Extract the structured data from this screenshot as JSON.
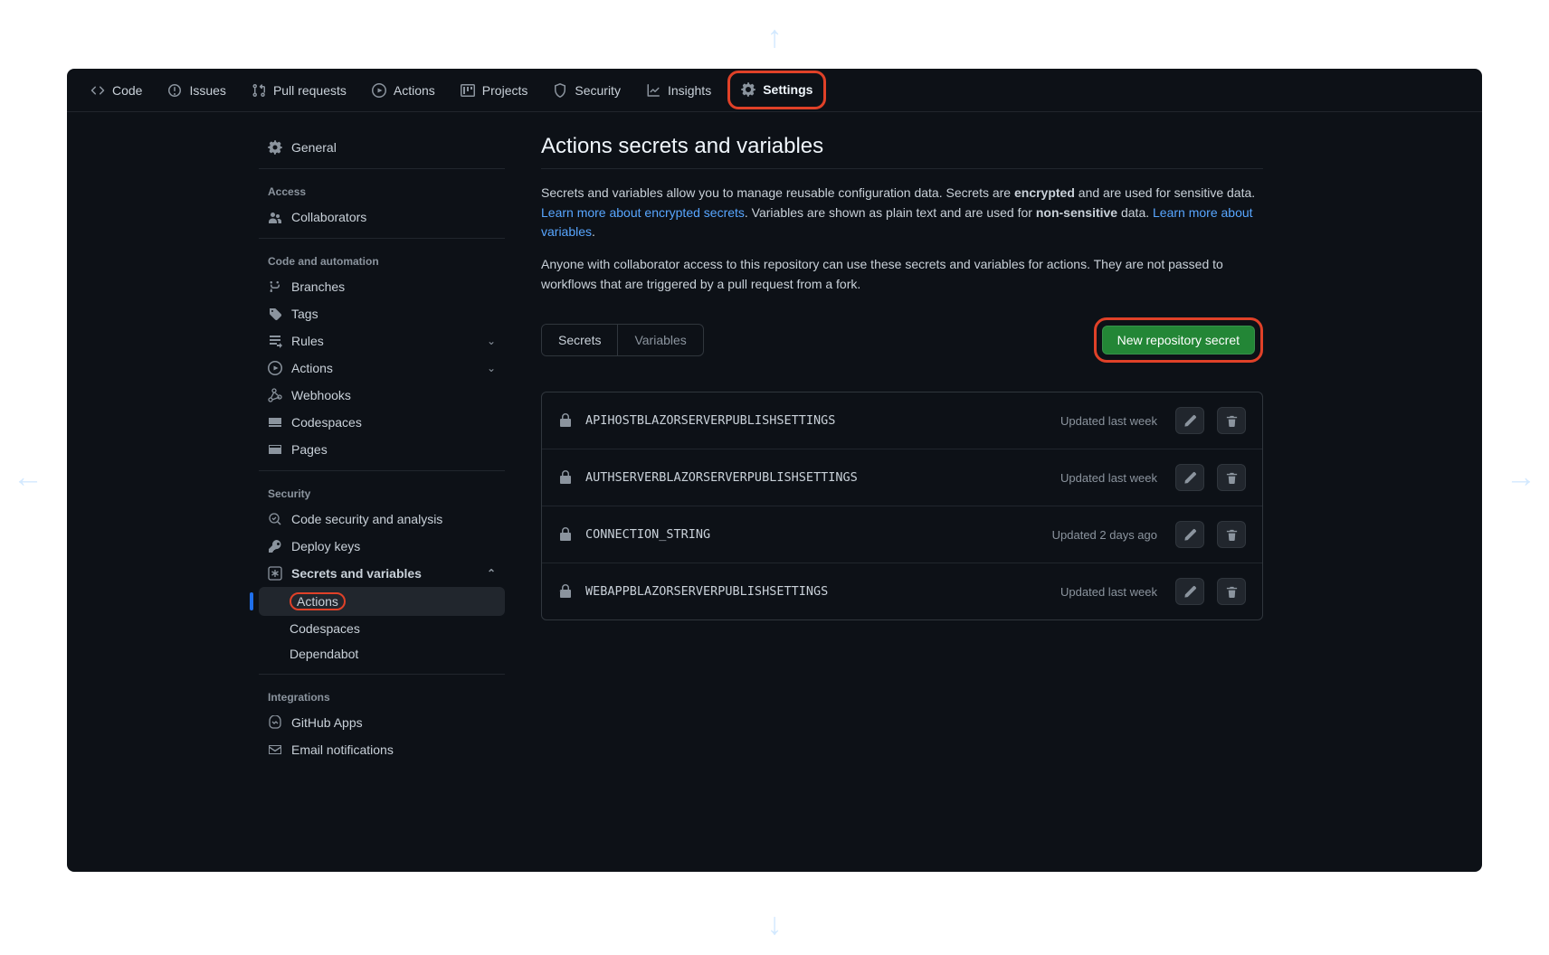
{
  "topnav": {
    "items": [
      {
        "label": "Code",
        "icon": "code"
      },
      {
        "label": "Issues",
        "icon": "issue"
      },
      {
        "label": "Pull requests",
        "icon": "pr"
      },
      {
        "label": "Actions",
        "icon": "play"
      },
      {
        "label": "Projects",
        "icon": "project"
      },
      {
        "label": "Security",
        "icon": "shield"
      },
      {
        "label": "Insights",
        "icon": "graph"
      },
      {
        "label": "Settings",
        "icon": "gear"
      }
    ]
  },
  "sidebar": {
    "general": "General",
    "section_access": "Access",
    "collaborators": "Collaborators",
    "section_code": "Code and automation",
    "branches": "Branches",
    "tags": "Tags",
    "rules": "Rules",
    "actions": "Actions",
    "webhooks": "Webhooks",
    "codespaces": "Codespaces",
    "pages": "Pages",
    "section_security": "Security",
    "code_security": "Code security and analysis",
    "deploy_keys": "Deploy keys",
    "secrets_vars": "Secrets and variables",
    "sv_actions": "Actions",
    "sv_codespaces": "Codespaces",
    "sv_dependabot": "Dependabot",
    "section_integrations": "Integrations",
    "github_apps": "GitHub Apps",
    "email_notifications": "Email notifications"
  },
  "main": {
    "title": "Actions secrets and variables",
    "desc1_a": "Secrets and variables allow you to manage reusable configuration data. Secrets are ",
    "desc1_b_bold": "encrypted",
    "desc1_c": " and are used for sensitive data. ",
    "link1": "Learn more about encrypted secrets",
    "desc1_d": ". Variables are shown as plain text and are used for ",
    "desc1_e_bold": "non-sensitive",
    "desc1_f": " data. ",
    "link2": "Learn more about variables",
    "desc1_g": ".",
    "desc2": "Anyone with collaborator access to this repository can use these secrets and variables for actions. They are not passed to workflows that are triggered by a pull request from a fork.",
    "tab_secrets": "Secrets",
    "tab_variables": "Variables",
    "new_secret_btn": "New repository secret",
    "secrets": [
      {
        "name": "APIHOSTBLAZORSERVERPUBLISHSETTINGS",
        "updated": "Updated last week"
      },
      {
        "name": "AUTHSERVERBLAZORSERVERPUBLISHSETTINGS",
        "updated": "Updated last week"
      },
      {
        "name": "CONNECTION_STRING",
        "updated": "Updated 2 days ago"
      },
      {
        "name": "WEBAPPBLAZORSERVERPUBLISHSETTINGS",
        "updated": "Updated last week"
      }
    ]
  }
}
